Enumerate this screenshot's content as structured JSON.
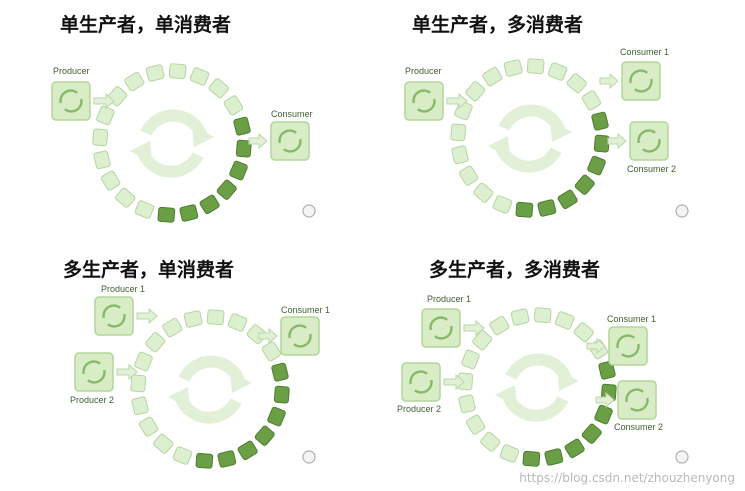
{
  "panels": [
    {
      "title": "单生产者，单消费者",
      "producers": [
        "Producer"
      ],
      "consumers": [
        "Consumer"
      ]
    },
    {
      "title": "单生产者，多消费者",
      "producers": [
        "Producer"
      ],
      "consumers": [
        "Consumer 1",
        "Consumer 2"
      ]
    },
    {
      "title": "多生产者，单消费者",
      "producers": [
        "Producer 1",
        "Producer 2"
      ],
      "consumers": [
        "Consumer 1"
      ]
    },
    {
      "title": "多生产者，多消费者",
      "producers": [
        "Producer 1",
        "Producer 2"
      ],
      "consumers": [
        "Consumer 1",
        "Consumer 2"
      ]
    }
  ],
  "watermark": "https://blog.csdn.net/zhouzhenyong",
  "colors": {
    "filled_slot": "#6a9f45",
    "empty_slot": "#dcefcf",
    "box": "#d8edc6",
    "box_border": "#b3d59c",
    "arrow": "#e1f0d6"
  }
}
